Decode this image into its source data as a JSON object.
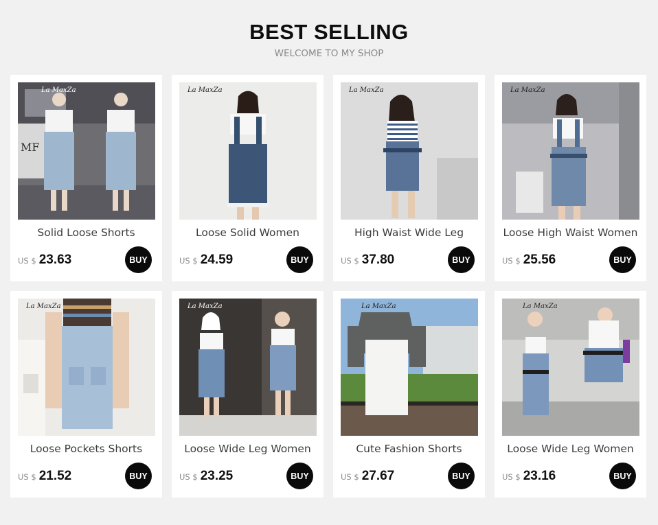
{
  "header": {
    "title": "BEST SELLING",
    "subtitle": "WELCOME TO MY SHOP"
  },
  "brand_watermark": "La MaxZa",
  "products": [
    {
      "name": "Solid Loose Shorts",
      "currency": "US $",
      "price": "23.63",
      "buy_label": "BUY"
    },
    {
      "name": "Loose Solid Women",
      "currency": "US $",
      "price": "24.59",
      "buy_label": "BUY"
    },
    {
      "name": "High Waist Wide Leg",
      "currency": "US $",
      "price": "37.80",
      "buy_label": "BUY"
    },
    {
      "name": "Loose High Waist Women",
      "currency": "US $",
      "price": "25.56",
      "buy_label": "BUY"
    },
    {
      "name": "Loose Pockets Shorts",
      "currency": "US $",
      "price": "21.52",
      "buy_label": "BUY"
    },
    {
      "name": "Loose Wide Leg Women",
      "currency": "US $",
      "price": "23.25",
      "buy_label": "BUY"
    },
    {
      "name": "Cute Fashion Shorts",
      "currency": "US $",
      "price": "27.67",
      "buy_label": "BUY"
    },
    {
      "name": "Loose Wide Leg Women",
      "currency": "US $",
      "price": "23.16",
      "buy_label": "BUY"
    }
  ],
  "colors": {
    "page_background": "#f1f1f1",
    "card_background": "#ffffff",
    "buy_button": "#0a0a0a",
    "denim_light": "#8fa8c4",
    "denim_dark": "#3d5677"
  }
}
